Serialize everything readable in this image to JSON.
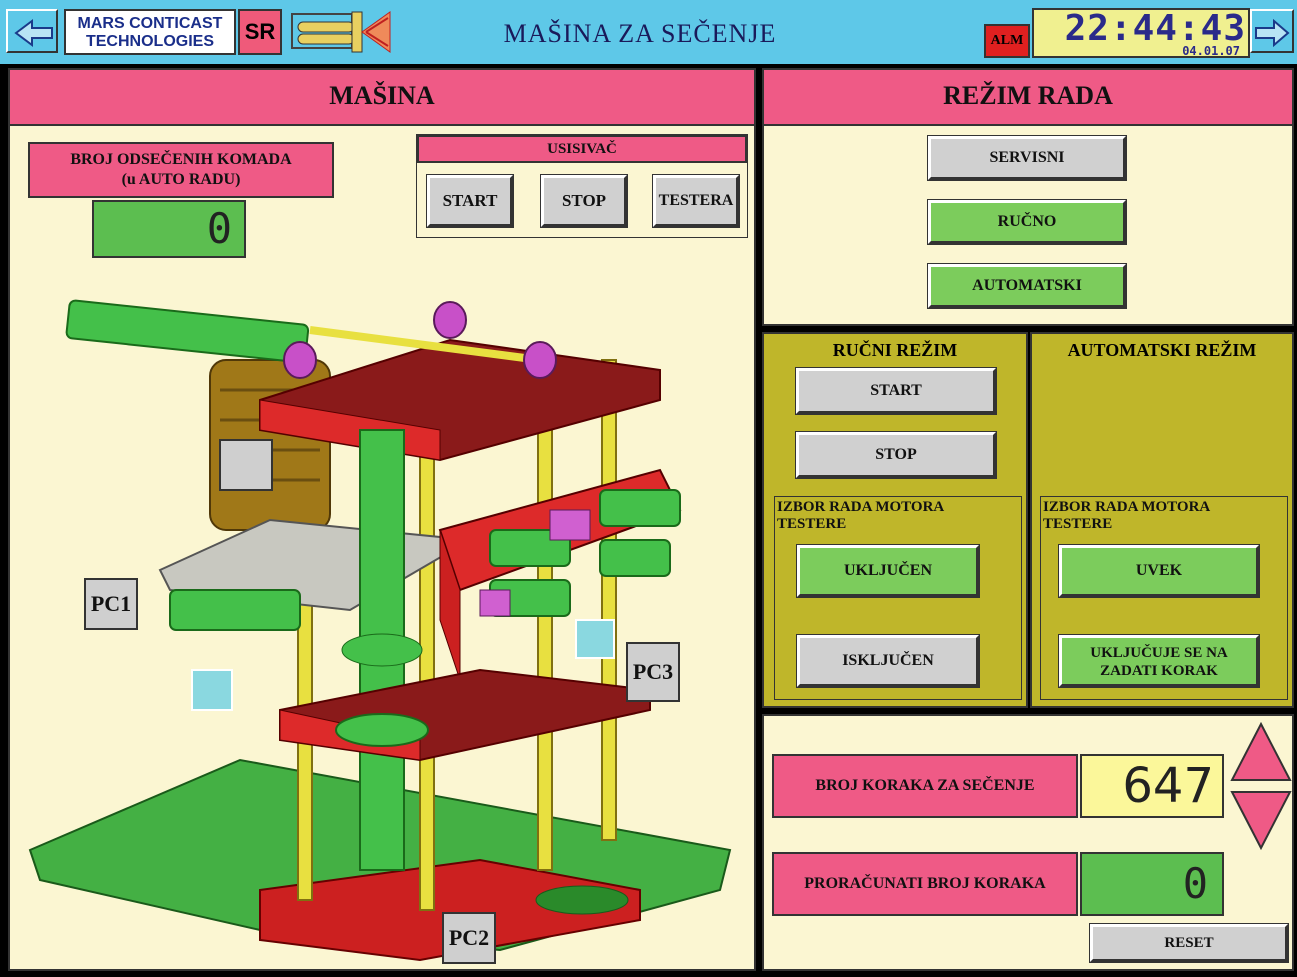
{
  "header": {
    "logo_line1": "MARS CONTICAST",
    "logo_line2": "TECHNOLOGIES",
    "language": "SR",
    "title": "MAŠINA ZA SEČENJE",
    "alarm_label": "ALM",
    "time": "22:44:43",
    "date": "04.01.07"
  },
  "machine": {
    "title": "MAŠINA",
    "cut_count_label_line1": "BROJ ODSEČENIH KOMADA",
    "cut_count_label_line2": "(u AUTO RADU)",
    "cut_count_value": "0",
    "vacuum": {
      "title": "USISIVAČ",
      "start": "START",
      "stop": "STOP",
      "saw": "TESTERA"
    },
    "sensors": {
      "pc1": "PC1",
      "pc2": "PC2",
      "pc3": "PC3"
    }
  },
  "mode": {
    "title": "REŽIM RADA",
    "service": "SERVISNI",
    "manual": "RUČNO",
    "automatic": "AUTOMATSKI"
  },
  "manual_mode": {
    "title": "RUČNI REŽIM",
    "start": "START",
    "stop": "STOP",
    "motor_select_line1": "IZBOR RADA MOTORA",
    "motor_select_line2": "TESTERE",
    "on": "UKLJUČEN",
    "off": "ISKLJUČEN"
  },
  "auto_mode": {
    "title": "AUTOMATSKI REŽIM",
    "motor_select_line1": "IZBOR RADA MOTORA",
    "motor_select_line2": "TESTERE",
    "always": "UVEK",
    "on_step_line1": "UKLJUČUJE SE NA",
    "on_step_line2": "ZADATI KORAK"
  },
  "steps": {
    "cut_steps_label": "BROJ KORAKA ZA SEČENJE",
    "cut_steps_value": "647",
    "calc_steps_label": "PRORAČUNATI BROJ KORAKA",
    "calc_steps_value": "0",
    "reset": "RESET"
  },
  "colors": {
    "header_bg": "#5ec8e8",
    "panel_bg": "#fbf6d2",
    "pink": "#ef5a86",
    "green": "#7ccc5c",
    "olive": "#bfb62a",
    "alarm": "#e02020"
  }
}
